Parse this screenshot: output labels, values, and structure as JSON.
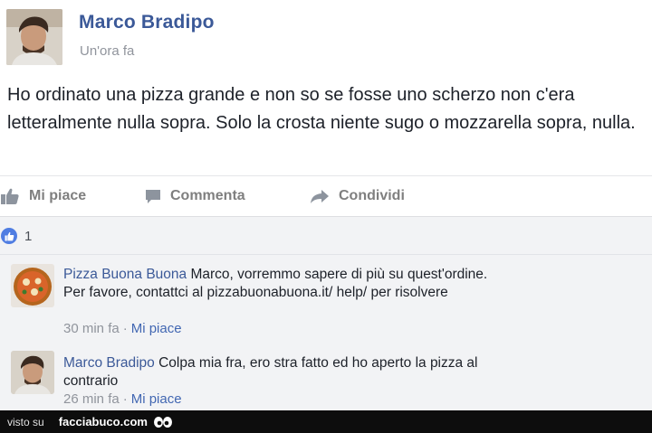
{
  "post": {
    "author": "Marco Bradipo",
    "time": "Un'ora fa",
    "text": "Ho ordinato una pizza grande e non so se fosse uno scherzo non c'era letteralmente nulla sopra. Solo la crosta niente sugo o mozzarella sopra, nulla."
  },
  "actions": {
    "like": "Mi piace",
    "comment": "Commenta",
    "share": "Condividi"
  },
  "reactions": {
    "count": "1"
  },
  "comments": [
    {
      "author": "Pizza Buona Buona",
      "text": "Marco, vorremmo sapere di più su quest'ordine. Per favore, contattci al pizzabuonabuona.it/ help/ per risolvere",
      "time": "30 min fa",
      "like": "Mi piace"
    },
    {
      "author": "Marco Bradipo",
      "text": "Colpa mia fra, ero stra fatto ed ho aperto la pizza al contrario",
      "time": "26 min fa",
      "like": "Mi piace"
    }
  ],
  "footer": {
    "prefix": "visto su",
    "brand": "facciabuco.com"
  },
  "colors": {
    "link": "#3b5998",
    "muted": "#90949c",
    "like_badge": "#4f7de2",
    "comments_bg": "#f2f3f5"
  },
  "icons": [
    "thumbs-up-icon",
    "comment-icon",
    "share-arrow-icon",
    "like-badge-icon",
    "eyes-icon"
  ]
}
